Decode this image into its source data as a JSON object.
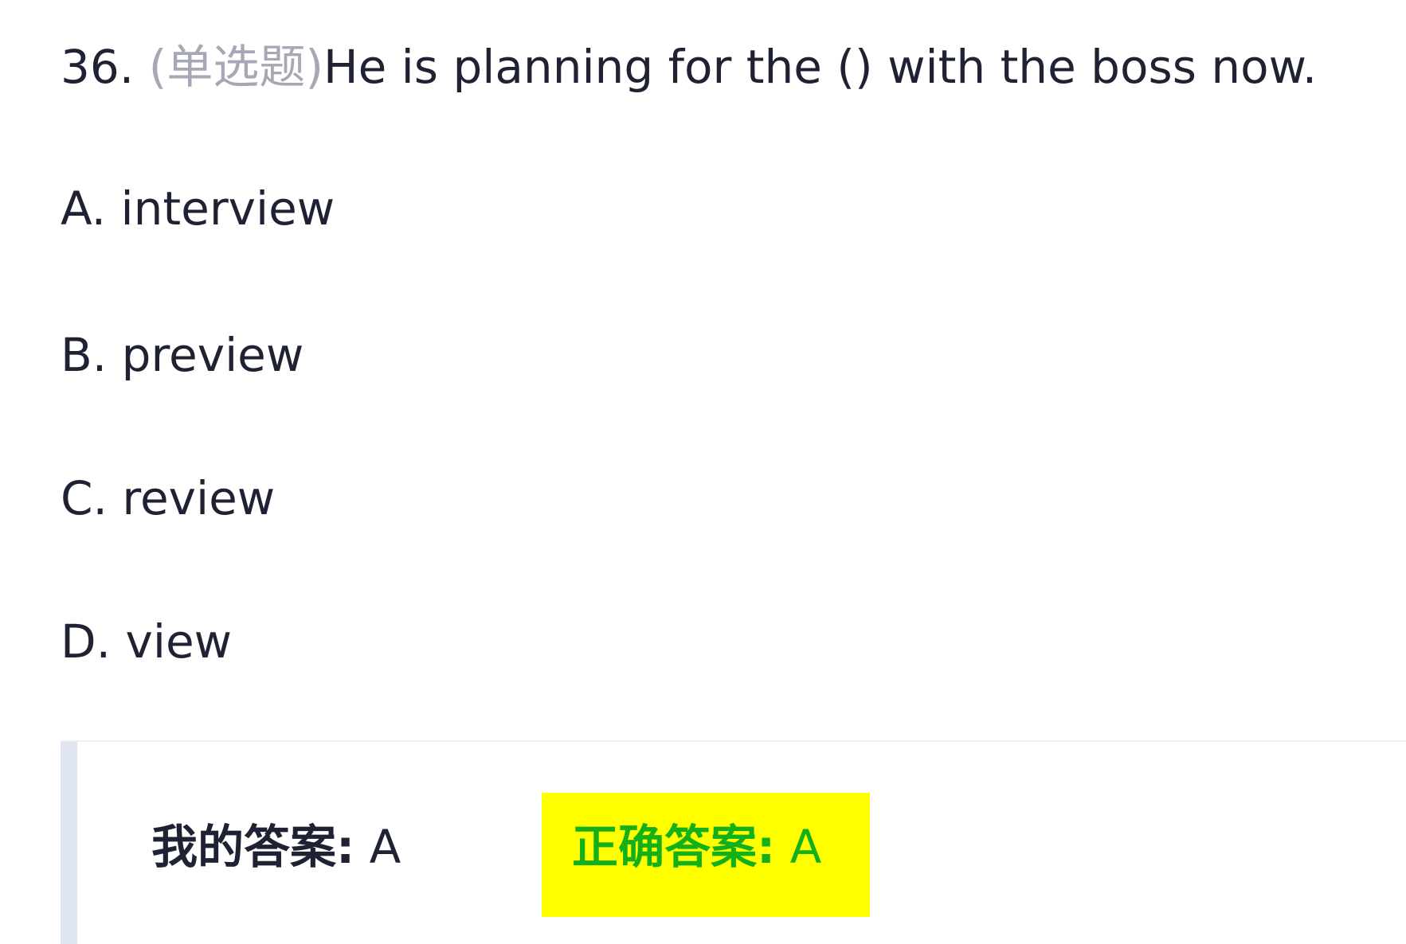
{
  "question": {
    "number": "36.",
    "type": "(单选题)",
    "text": "He is planning for the () with the boss now."
  },
  "options": [
    {
      "letter": "A.",
      "text": "interview"
    },
    {
      "letter": "B.",
      "text": "preview"
    },
    {
      "letter": "C.",
      "text": "review"
    },
    {
      "letter": "D.",
      "text": "view"
    }
  ],
  "answer": {
    "my_label": "我的答案:",
    "my_value": "A",
    "correct_label": "正确答案:",
    "correct_value": "A"
  },
  "colors": {
    "text": "#1f2233",
    "muted": "#a6a8b6",
    "correct_text": "#13b01a",
    "highlight": "#ffff00",
    "side_bar": "#dfe6f0"
  }
}
